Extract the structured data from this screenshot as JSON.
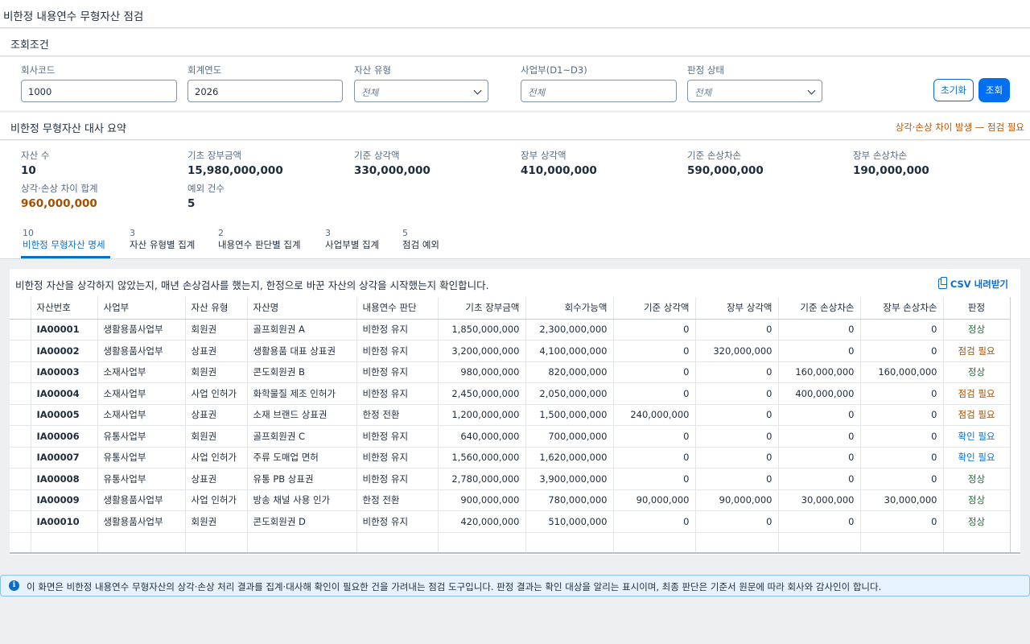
{
  "app": {
    "title": "비한정 내용연수 무형자산 점검"
  },
  "filters": {
    "section_title": "조회조건",
    "company_code": {
      "label": "회사코드",
      "value": "1000"
    },
    "fiscal_year": {
      "label": "회계연도",
      "value": "2026"
    },
    "asset_type": {
      "label": "자산 유형",
      "placeholder": "전체"
    },
    "division": {
      "label": "사업부(D1~D3)",
      "placeholder": "전체"
    },
    "status": {
      "label": "판정 상태",
      "placeholder": "전체"
    },
    "reset_label": "초기화",
    "search_label": "조회"
  },
  "summary": {
    "title": "비한정 무형자산 대사 요약",
    "warning": "상각·손상 차이 발생 — 점검 필요",
    "kpis": [
      {
        "label": "자산 수",
        "value": "10"
      },
      {
        "label": "기초 장부금액",
        "value": "15,980,000,000"
      },
      {
        "label": "기준 상각액",
        "value": "330,000,000"
      },
      {
        "label": "장부 상각액",
        "value": "410,000,000"
      },
      {
        "label": "기준 손상차손",
        "value": "590,000,000"
      },
      {
        "label": "장부 손상차손",
        "value": "190,000,000"
      },
      {
        "label": "상각·손상 차이 합계",
        "value": "960,000,000"
      },
      {
        "label": "예외 건수",
        "value": "5"
      }
    ]
  },
  "tabs": [
    {
      "count": "10",
      "label": "비한정 무형자산 명세"
    },
    {
      "count": "3",
      "label": "자산 유형별 집계"
    },
    {
      "count": "2",
      "label": "내용연수 판단별 집계"
    },
    {
      "count": "3",
      "label": "사업부별 집계"
    },
    {
      "count": "5",
      "label": "점검 예외"
    }
  ],
  "table": {
    "hint": "비한정 자산을 상각하지 않았는지, 매년 손상검사를 했는지, 한정으로 바꾼 자산의 상각을 시작했는지 확인합니다.",
    "csv_label": "CSV 내려받기",
    "columns": [
      "자산번호",
      "사업부",
      "자산 유형",
      "자산명",
      "내용연수 판단",
      "기초 장부금액",
      "회수가능액",
      "기준 상각액",
      "장부 상각액",
      "기준 손상차손",
      "장부 손상차손",
      "판정"
    ],
    "rows": [
      [
        "IA00001",
        "생활용품사업부",
        "회원권",
        "골프회원권 A",
        "비한정 유지",
        "1,850,000,000",
        "2,300,000,000",
        "0",
        "0",
        "0",
        "0",
        "정상"
      ],
      [
        "IA00002",
        "생활용품사업부",
        "상표권",
        "생활용품 대표 상표권",
        "비한정 유지",
        "3,200,000,000",
        "4,100,000,000",
        "0",
        "320,000,000",
        "0",
        "0",
        "점검 필요"
      ],
      [
        "IA00003",
        "소재사업부",
        "회원권",
        "콘도회원권 B",
        "비한정 유지",
        "980,000,000",
        "820,000,000",
        "0",
        "0",
        "160,000,000",
        "160,000,000",
        "정상"
      ],
      [
        "IA00004",
        "소재사업부",
        "사업 인허가",
        "화학물질 제조 인허가",
        "비한정 유지",
        "2,450,000,000",
        "2,050,000,000",
        "0",
        "0",
        "400,000,000",
        "0",
        "점검 필요"
      ],
      [
        "IA00005",
        "소재사업부",
        "상표권",
        "소재 브랜드 상표권",
        "한정 전환",
        "1,200,000,000",
        "1,500,000,000",
        "240,000,000",
        "0",
        "0",
        "0",
        "점검 필요"
      ],
      [
        "IA00006",
        "유통사업부",
        "회원권",
        "골프회원권 C",
        "비한정 유지",
        "640,000,000",
        "700,000,000",
        "0",
        "0",
        "0",
        "0",
        "확인 필요"
      ],
      [
        "IA00007",
        "유통사업부",
        "사업 인허가",
        "주류 도매업 면허",
        "비한정 유지",
        "1,560,000,000",
        "1,620,000,000",
        "0",
        "0",
        "0",
        "0",
        "확인 필요"
      ],
      [
        "IA00008",
        "유통사업부",
        "상표권",
        "유통 PB 상표권",
        "비한정 유지",
        "2,780,000,000",
        "3,900,000,000",
        "0",
        "0",
        "0",
        "0",
        "정상"
      ],
      [
        "IA00009",
        "생활용품사업부",
        "사업 인허가",
        "방송 채널 사용 인가",
        "한정 전환",
        "900,000,000",
        "780,000,000",
        "90,000,000",
        "90,000,000",
        "30,000,000",
        "30,000,000",
        "정상"
      ],
      [
        "IA00010",
        "생활용품사업부",
        "회원권",
        "콘도회원권 D",
        "비한정 유지",
        "420,000,000",
        "510,000,000",
        "0",
        "0",
        "0",
        "0",
        "정상"
      ]
    ]
  },
  "footer": {
    "icon": "info-icon",
    "text": "이 화면은 비한정 내용연수 무형자산의 상각·손상 처리 결과를 집계·대사해 확인이 필요한 건을 가려내는 점검 도구입니다. 판정 결과는 확인 대상을 알리는 표시이며, 최종 판단은 기준서 원문에 따라 회사와 감사인이 합니다."
  },
  "colors": {
    "accent": "#0a6ed1",
    "ok": "#256f3a",
    "warn": "#a34f00",
    "info": "#0a6ed1"
  }
}
